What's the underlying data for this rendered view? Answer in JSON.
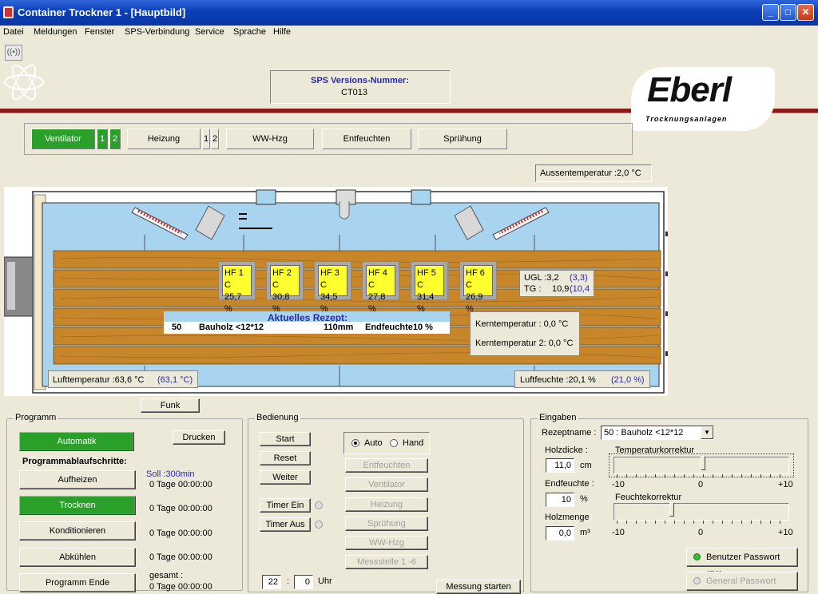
{
  "window": {
    "title": "Container Trockner 1 - [Hauptbild]",
    "minimize": "_",
    "maximize": "□",
    "close": "✕"
  },
  "menu": [
    "Datei",
    "Meldungen",
    "Fenster",
    "SPS-Verbindung",
    "Service",
    "Sprache",
    "Hilfe"
  ],
  "sps": {
    "label": "SPS Versions-Nummer:",
    "value": "CT013"
  },
  "logo": {
    "name": "Eberl",
    "sub": "Trocknungsanlagen"
  },
  "status": {
    "ventilator": "Ventilator",
    "v1": "1",
    "v2": "2",
    "heizung": "Heizung",
    "h1": "1",
    "h2": "2",
    "ww": "WW-Hzg",
    "entfeuchten": "Entfeuchten",
    "spruehung": "Sprühung"
  },
  "aussentemperatur": "Aussentemperatur :2,0  °C",
  "sensors": [
    {
      "name": "HF 1 C",
      "value": "25,7  %"
    },
    {
      "name": "HF 2 C",
      "value": "30,8  %"
    },
    {
      "name": "HF 3 C",
      "value": "34,5  %"
    },
    {
      "name": "HF 4 C",
      "value": "27,8  %"
    },
    {
      "name": "HF 5 C",
      "value": "31,4  %"
    },
    {
      "name": "HF 6 C",
      "value": "26,9  %"
    }
  ],
  "ugl": {
    "label": "UGL :3,2",
    "val": "(3,3)",
    "tg_label": "TG :",
    "tg": "10,9",
    "tg_val": "(10,4"
  },
  "rezept": {
    "title": "Aktuelles Rezept:",
    "nr": "50",
    "name": "Bauholz <12*12",
    "dicke": "110mm",
    "endfeuchte": "Endfeuchte10 %"
  },
  "kern": {
    "k1": "Kerntemperatur :  0,0  °C",
    "k2": "Kerntemperatur 2:  0,0  °C"
  },
  "luft": {
    "temp": "Lufttemperatur :63,6 °C",
    "temp_soll": "(63,1  °C)",
    "feuchte": "Luftfeuchte :20,1  %",
    "feuchte_soll": "(21,0  %)"
  },
  "funk": "Funk",
  "programm": {
    "title": "Programm",
    "automatik": "Automatik",
    "drucken": "Drucken",
    "schritte": "Programmablaufschritte:",
    "steps": [
      {
        "label": "Aufheizen",
        "time": "0 Tage 00:00:00"
      },
      {
        "label": "Trocknen",
        "time": "0 Tage 00:00:00"
      },
      {
        "label": "Konditionieren",
        "time": "0 Tage 00:00:00"
      },
      {
        "label": "Abkühlen",
        "time": "0 Tage 00:00:00"
      },
      {
        "label": "Programm Ende",
        "time": "0 Tage 00:00:00"
      }
    ],
    "soll": "Soll :300min",
    "gesamt": "gesamt :"
  },
  "bedienung": {
    "title": "Bedienung",
    "start": "Start",
    "reset": "Reset",
    "weiter": "Weiter",
    "timer_ein": "Timer Ein",
    "timer_aus": "Timer Aus",
    "auto": "Auto",
    "hand": "Hand",
    "manual": [
      "Entfeuchten",
      "Ventilator",
      "Heizung",
      "Sprühung",
      "WW-Hzg",
      "Messstelle 1 -6"
    ],
    "hour": "22",
    "minute": "0",
    "sep": ":",
    "uhr": "Uhr",
    "messung": "Messung starten"
  },
  "eingaben": {
    "title": "Eingaben",
    "rezeptname_label": "Rezeptname :",
    "rezeptname": "50 : Bauholz <12*12",
    "holzdicke_label": "Holzdicke :",
    "holzdicke": "11,0",
    "holzdicke_unit": "cm",
    "endfeuchte_label": "Endfeuchte :",
    "endfeuchte": "10",
    "endfeuchte_unit": "%",
    "holzmenge_label": "Holzmenge",
    "holzmenge": "0,0",
    "holzmenge_unit": "m³",
    "temp_korr": "Temperaturkorrektur",
    "feucht_korr": "Feuchtekorrektur",
    "temp_korr_value": 0.2,
    "feucht_korr_value": -3.5,
    "min": "-10",
    "mid": "0",
    "max": "+10",
    "benutzer": "Benutzer Passwort (F2)",
    "general": "General Passwort"
  },
  "colors": {
    "title": "#0b3fb8",
    "green": "#2aa02a",
    "hf": "#ffff30",
    "wood": "#c8862a",
    "chamber": "#a8d4f0",
    "red": "#8b1a1a"
  }
}
